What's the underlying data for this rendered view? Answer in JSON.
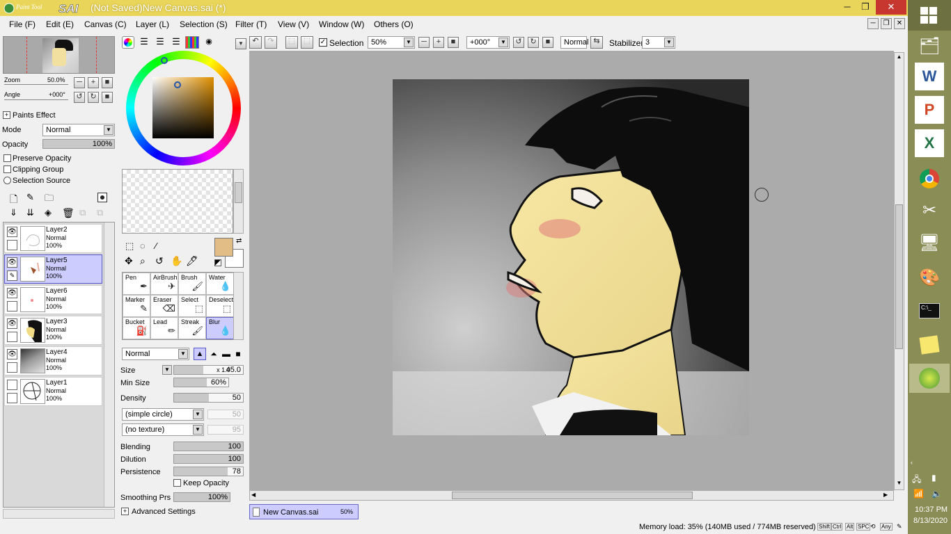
{
  "window": {
    "app_logo": "PaintTool SAI",
    "title": "(Not Saved)New Canvas.sai (*)",
    "minimize": "─",
    "restore": "❐",
    "close": "✕"
  },
  "menu": [
    "File (F)",
    "Edit (E)",
    "Canvas (C)",
    "Layer (L)",
    "Selection (S)",
    "Filter (T)",
    "View (V)",
    "Window (W)",
    "Others (O)"
  ],
  "navigator": {
    "zoom_label": "Zoom",
    "zoom_value": "50.0%",
    "angle_label": "Angle",
    "angle_value": "+000°"
  },
  "layer_panel": {
    "paints_effect": "Paints Effect",
    "mode_label": "Mode",
    "mode_value": "Normal",
    "opacity_label": "Opacity",
    "opacity_value": "100%",
    "preserve_opacity": "Preserve Opacity",
    "clipping_group": "Clipping Group",
    "selection_source": "Selection Source",
    "layers": [
      {
        "name": "Layer2",
        "mode": "Normal",
        "opacity": "100%",
        "selected": false
      },
      {
        "name": "Layer5",
        "mode": "Normal",
        "opacity": "100%",
        "selected": true
      },
      {
        "name": "Layer6",
        "mode": "Normal",
        "opacity": "100%",
        "selected": false
      },
      {
        "name": "Layer3",
        "mode": "Normal",
        "opacity": "100%",
        "selected": false
      },
      {
        "name": "Layer4",
        "mode": "Normal",
        "opacity": "100%",
        "selected": false
      },
      {
        "name": "Layer1",
        "mode": "Normal",
        "opacity": "100%",
        "selected": false
      }
    ]
  },
  "colors": {
    "primary": "#e2bd86",
    "secondary": "#ffffff",
    "accent_selected": "#ccccff",
    "titlebar": "#e9d559"
  },
  "tools": [
    {
      "name": "Pen",
      "icon": "pen-icon"
    },
    {
      "name": "AirBrush",
      "icon": "airbrush-icon"
    },
    {
      "name": "Brush",
      "icon": "brush-icon"
    },
    {
      "name": "Water",
      "icon": "water-icon"
    },
    {
      "name": "Marker",
      "icon": "marker-icon"
    },
    {
      "name": "Eraser",
      "icon": "eraser-icon"
    },
    {
      "name": "Select",
      "icon": "select-icon"
    },
    {
      "name": "Deselect",
      "icon": "deselect-icon"
    },
    {
      "name": "Bucket",
      "icon": "bucket-icon"
    },
    {
      "name": "Lead",
      "icon": "lead-icon"
    },
    {
      "name": "Streak",
      "icon": "streak-icon"
    },
    {
      "name": "Blur",
      "icon": "blur-icon",
      "selected": true
    }
  ],
  "brush": {
    "blend_mode": "Normal",
    "size_label": "Size",
    "size_mult": "x 1.0",
    "size_value": "45.0",
    "min_size_label": "Min Size",
    "min_size_value": "60%",
    "density_label": "Density",
    "density_value": "50",
    "shape": "(simple circle)",
    "shape_value": "50",
    "texture": "(no texture)",
    "texture_value": "95",
    "blending_label": "Blending",
    "blending_value": "100",
    "dilution_label": "Dilution",
    "dilution_value": "100",
    "persistence_label": "Persistence",
    "persistence_value": "78",
    "keep_opacity": "Keep Opacity",
    "smoothing_label": "Smoothing Prs",
    "smoothing_value": "100%",
    "advanced": "Advanced Settings"
  },
  "toolbar": {
    "selection_label": "Selection",
    "zoom": "50%",
    "angle": "+000°",
    "blend": "Normal",
    "stabilizer_label": "Stabilizer",
    "stabilizer_value": "3"
  },
  "tab": {
    "name": "New Canvas.sai",
    "zoom": "50%"
  },
  "status": {
    "memory": "Memory load: 35% (140MB used / 774MB reserved)",
    "keys": [
      "Shift",
      "Ctrl",
      "Alt",
      "SPC",
      "Any"
    ]
  },
  "clock": {
    "time": "10:37 PM",
    "date": "8/13/2020"
  }
}
